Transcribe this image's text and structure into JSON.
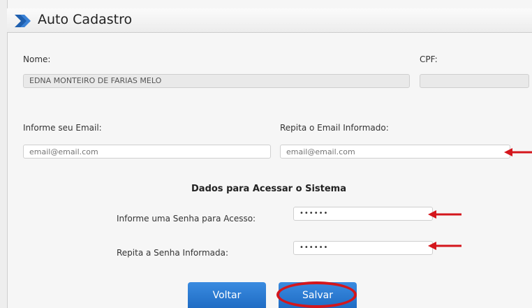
{
  "header": {
    "title": "Auto Cadastro",
    "icon": "chevron-right-icon"
  },
  "fields": {
    "nome_label": "Nome:",
    "nome_value": "EDNA MONTEIRO DE FARIAS MELO",
    "cpf_label": "CPF:",
    "cpf_value": "",
    "email_label": "Informe seu Email:",
    "email_placeholder": "email@email.com",
    "email_repeat_label": "Repita o Email Informado:",
    "email_repeat_placeholder": "email@email.com"
  },
  "access": {
    "heading": "Dados para Acessar o Sistema",
    "password_label": "Informe uma Senha para Acesso:",
    "password_value": "••••••",
    "password_repeat_label": "Repita a Senha Informada:",
    "password_repeat_value": "••••••"
  },
  "buttons": {
    "back": "Voltar",
    "save": "Salvar"
  },
  "colors": {
    "accent": "#1f6cc4",
    "annotation": "#d4161c",
    "title_icon": "#1f5fae"
  }
}
